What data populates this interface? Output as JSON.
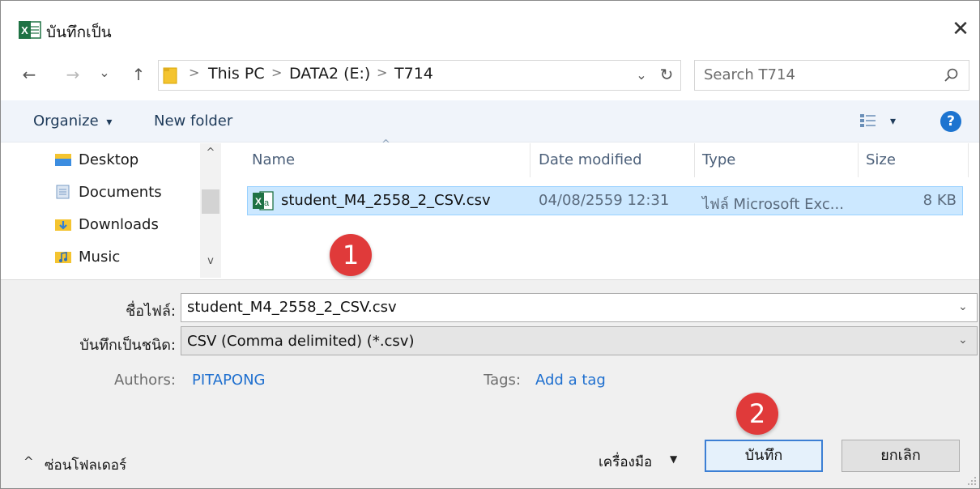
{
  "window": {
    "title": "บันทึกเป็น",
    "close_glyph": "✕",
    "app_icon": "excel-icon",
    "app_icon_letter": "X"
  },
  "nav": {
    "back_glyph": "←",
    "forward_glyph": "→",
    "recent_glyph": "⌄",
    "up_glyph": "↑",
    "breadcrumb": [
      "This PC",
      "DATA2 (E:)",
      "T714"
    ],
    "crumb_separator": ">",
    "dropdown_glyph": "⌄",
    "refresh_glyph": "↻",
    "search_placeholder": "Search T714",
    "search_glyph": "⌕"
  },
  "toolbar": {
    "organize_label": "Organize",
    "organize_caret": "▾",
    "new_folder_label": "New folder",
    "view_caret": "▾",
    "help_label": "?"
  },
  "sidebar": {
    "items": [
      {
        "label": "Desktop",
        "icon": "desktop-folder-icon"
      },
      {
        "label": "Documents",
        "icon": "documents-folder-icon"
      },
      {
        "label": "Downloads",
        "icon": "downloads-folder-icon"
      },
      {
        "label": "Music",
        "icon": "music-folder-icon"
      }
    ],
    "scroll_up": "^",
    "scroll_down": "v"
  },
  "file_list": {
    "sort_indicator": "^",
    "columns": [
      "Name",
      "Date modified",
      "Type",
      "Size"
    ],
    "rows": [
      {
        "name": "student_M4_2558_2_CSV.csv",
        "date_modified": "04/08/2559 12:31",
        "type": "ไฟล์ Microsoft Exc...",
        "size": "8 KB",
        "icon": "excel-csv-file-icon",
        "selected": true
      }
    ]
  },
  "annotations": {
    "step1": "1",
    "step2": "2",
    "color": "#e03a3a"
  },
  "form": {
    "filename_label": "ชื่อไฟล์:",
    "filename_value": "student_M4_2558_2_CSV.csv",
    "filetype_label": "บันทึกเป็นชนิด:",
    "filetype_value": "CSV (Comma delimited) (*.csv)",
    "select_glyph": "⌄",
    "authors_label": "Authors:",
    "authors_value": "PITAPONG",
    "tags_label": "Tags:",
    "tags_value": "Add a tag"
  },
  "footer": {
    "hide_folders_glyph": "^",
    "hide_folders_label": "ซ่อนโฟลเดอร์",
    "tools_label": "เครื่องมือ",
    "tools_caret": "▼",
    "save_label": "บันทึก",
    "cancel_label": "ยกเลิก"
  },
  "colors": {
    "selection_bg": "#cce8ff",
    "link": "#1e6fcf",
    "excel_green": "#1f7244",
    "help_blue": "#1d74d0"
  }
}
